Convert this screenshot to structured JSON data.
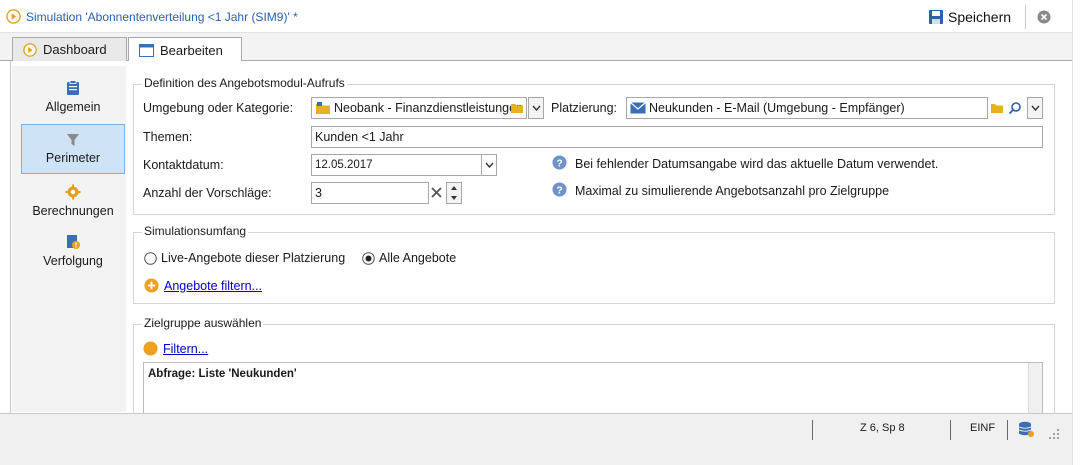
{
  "window": {
    "title": "Simulation 'Abonnentenverteilung <1 Jahr  (SIM9)' *",
    "save_label": "Speichern"
  },
  "tabs": [
    {
      "label": "Dashboard"
    },
    {
      "label": "Bearbeiten"
    }
  ],
  "sidebar": {
    "items": [
      {
        "label": "Allgemein"
      },
      {
        "label": "Perimeter"
      },
      {
        "label": "Berechnungen"
      },
      {
        "label": "Verfolgung"
      }
    ]
  },
  "definition": {
    "title": "Definition des Angebotsmodul-Aufrufs",
    "env_label": "Umgebung oder Kategorie:",
    "env_value": "Neobank - Finanzdienstleistungen",
    "placement_label": "Platzierung:",
    "placement_value": "Neukunden - E-Mail (Umgebung - Empfänger)",
    "themes_label": "Themen:",
    "themes_value": "Kunden <1 Jahr",
    "contact_label": "Kontaktdatum:",
    "contact_value": "12.05.2017",
    "count_label": "Anzahl der Vorschläge:",
    "count_value": "3",
    "hint_date": "Bei fehlender Datumsangabe wird das aktuelle Datum verwendet.",
    "hint_max": "Maximal zu simulierende Angebotsanzahl pro Zielgruppe"
  },
  "scope": {
    "title": "Simulationsumfang",
    "radio_live": "Live-Angebote dieser Platzierung",
    "radio_all": "Alle Angebote",
    "filter_link": "Angebote filtern..."
  },
  "target": {
    "title": "Zielgruppe auswählen",
    "filter_link": "Filtern...",
    "query_text": "Abfrage: Liste 'Neukunden'"
  },
  "status": {
    "position": "Z 6, Sp 8",
    "mode": "EINF"
  },
  "colors": {
    "accent": "#2a5faa",
    "sidebar_active": "#cfe3f7",
    "orange": "#f0a020",
    "link": "#0000cc"
  }
}
